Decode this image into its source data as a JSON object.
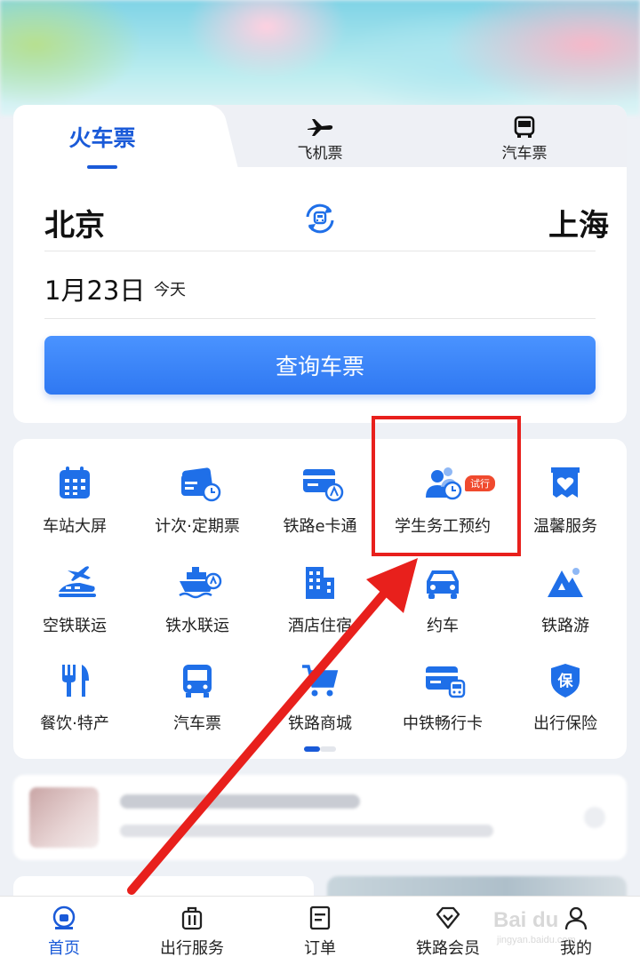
{
  "tabs": [
    {
      "label": "火车票",
      "icon": "train-tab",
      "active": true
    },
    {
      "label": "飞机票",
      "icon": "airplane-icon",
      "active": false
    },
    {
      "label": "汽车票",
      "icon": "bus-icon",
      "active": false
    }
  ],
  "route": {
    "from": "北京",
    "to": "上海",
    "swap_icon": "swap-icon"
  },
  "date": {
    "value": "1月23日",
    "sub": "今天"
  },
  "search_button": "查询车票",
  "services": [
    {
      "label": "车站大屏",
      "icon": "calendar-icon"
    },
    {
      "label": "计次·定期票",
      "icon": "ticket-clock-icon"
    },
    {
      "label": "铁路e卡通",
      "icon": "card-train-icon"
    },
    {
      "label": "学生务工预约",
      "icon": "person-clock-icon",
      "badge": "试行"
    },
    {
      "label": "温馨服务",
      "icon": "heart-bag-icon"
    },
    {
      "label": "空铁联运",
      "icon": "plane-train-icon"
    },
    {
      "label": "铁水联运",
      "icon": "ship-icon"
    },
    {
      "label": "酒店住宿",
      "icon": "building-icon"
    },
    {
      "label": "约车",
      "icon": "car-icon"
    },
    {
      "label": "铁路游",
      "icon": "mountain-icon"
    },
    {
      "label": "餐饮·特产",
      "icon": "cutlery-icon"
    },
    {
      "label": "汽车票",
      "icon": "bus-front-icon"
    },
    {
      "label": "铁路商城",
      "icon": "cart-icon"
    },
    {
      "label": "中铁畅行卡",
      "icon": "card-train2-icon"
    },
    {
      "label": "出行保险",
      "icon": "shield-icon"
    }
  ],
  "bottom_nav": [
    {
      "label": "首页",
      "icon": "home-icon",
      "active": true
    },
    {
      "label": "出行服务",
      "icon": "luggage-icon",
      "active": false
    },
    {
      "label": "订单",
      "icon": "document-icon",
      "active": false
    },
    {
      "label": "铁路会员",
      "icon": "diamond-icon",
      "active": false
    },
    {
      "label": "我的",
      "icon": "user-icon",
      "active": false
    }
  ],
  "watermark": {
    "text": "Bai du",
    "sub": "jingyan.baidu.com"
  },
  "colors": {
    "accent": "#1a5ad8",
    "icon_blue": "#1f6fe8",
    "annotation_red": "#e8201c",
    "badge_red": "#f04a2e"
  }
}
